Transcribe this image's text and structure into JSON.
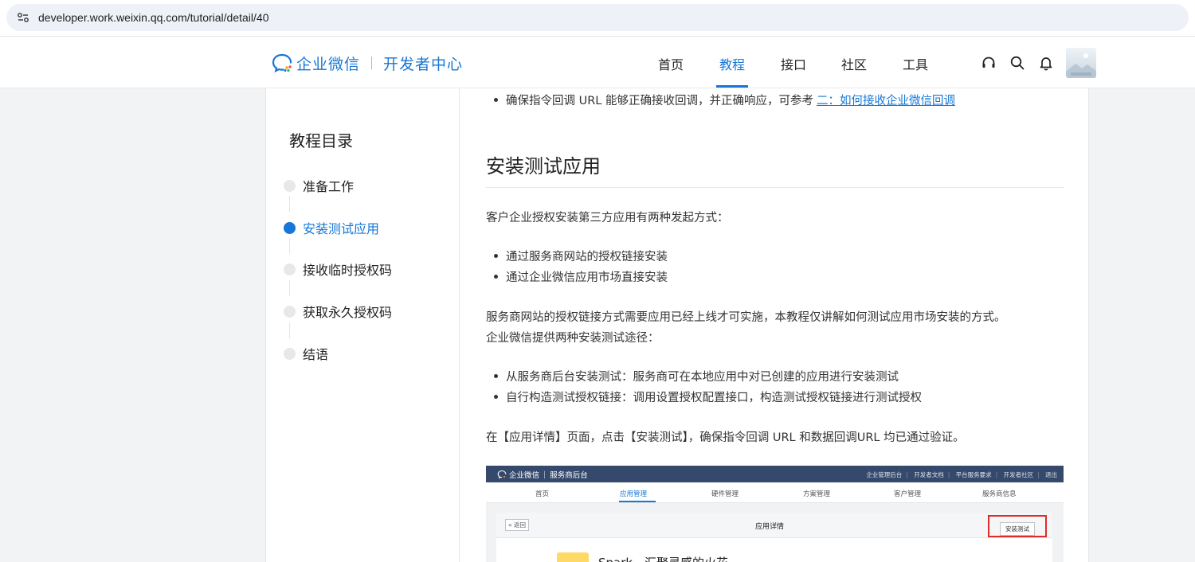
{
  "browser": {
    "url": "developer.work.weixin.qq.com/tutorial/detail/40",
    "site_icon": "site-settings-icon"
  },
  "header": {
    "logo_text": "企业微信",
    "logo_sub": "开发者中心",
    "nav": [
      {
        "label": "首页",
        "active": false
      },
      {
        "label": "教程",
        "active": true
      },
      {
        "label": "接口",
        "active": false
      },
      {
        "label": "社区",
        "active": false
      },
      {
        "label": "工具",
        "active": false
      }
    ],
    "icons": [
      "headset-icon",
      "search-icon",
      "bell-icon",
      "avatar"
    ],
    "accent": "#1677d6"
  },
  "sidebar": {
    "title": "教程目录",
    "items": [
      {
        "label": "准备工作",
        "active": false
      },
      {
        "label": "安装测试应用",
        "active": true
      },
      {
        "label": "接收临时授权码",
        "active": false
      },
      {
        "label": "获取永久授权码",
        "active": false
      },
      {
        "label": "结语",
        "active": false
      }
    ]
  },
  "content": {
    "top_bullet_text": "确保指令回调 URL 能够正确接收回调，并正确响应，可参考",
    "top_bullet_link": "二：如何接收企业微信回调",
    "heading": "安装测试应用",
    "intro": "客户企业授权安装第三方应用有两种发起方式：",
    "methods": [
      "通过服务商网站的授权链接安装",
      "通过企业微信应用市场直接安装"
    ],
    "note_line1": "服务商网站的授权链接方式需要应用已经上线才可实施，本教程仅讲解如何测试应用市场安装的方式。",
    "note_line2": "企业微信提供两种安装测试途径：",
    "paths": [
      "从服务商后台安装测试：服务商可在本地应用中对已创建的应用进行安装测试",
      "自行构造测试授权链接：调用设置授权配置接口，构造测试授权链接进行测试授权"
    ],
    "instruction": "在【应用详情】页面，点击【安装测试】，确保指令回调 URL 和数据回调URL 均已通过验证。"
  },
  "screenshot": {
    "logo": "企业微信",
    "subtitle": "服务商后台",
    "top_links": [
      "企业管理后台",
      "开发者文档",
      "平台服务要求",
      "开发者社区",
      "退出"
    ],
    "tabs": [
      {
        "label": "首页",
        "active": false
      },
      {
        "label": "应用管理",
        "active": true
      },
      {
        "label": "硬件管理",
        "active": false
      },
      {
        "label": "方案管理",
        "active": false
      },
      {
        "label": "客户管理",
        "active": false
      },
      {
        "label": "服务商信息",
        "active": false
      }
    ],
    "back_label": "« 返回",
    "page_title": "应用详情",
    "install_button": "安装测试",
    "app_name": "Spark - 汇聚灵感的火花"
  }
}
